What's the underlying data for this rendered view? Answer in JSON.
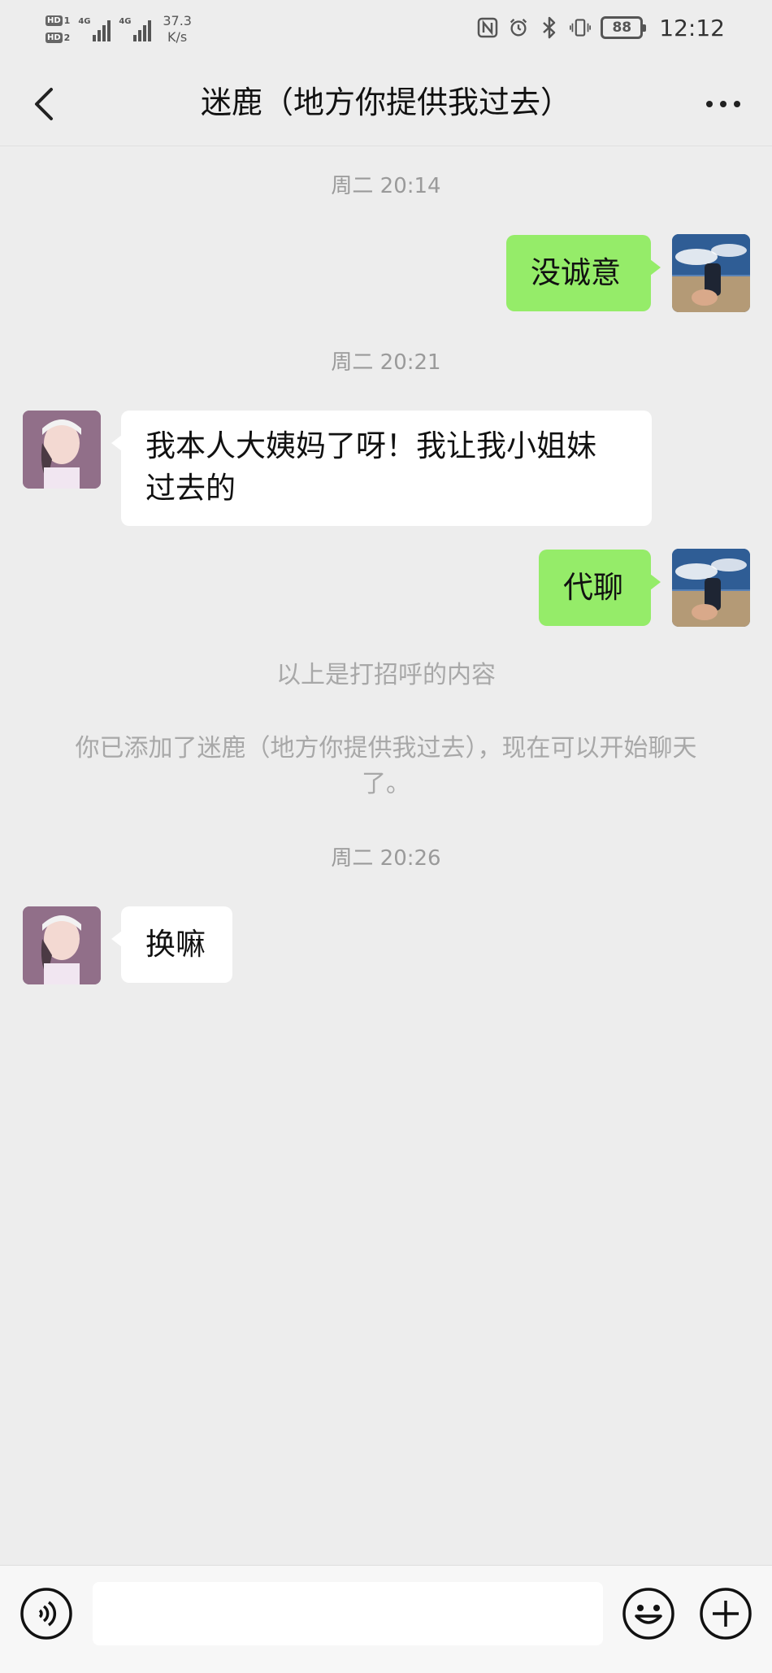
{
  "status_bar": {
    "hd1": "HD",
    "sim1": "1",
    "hd2": "HD",
    "sim2": "2",
    "signal1_tag": "4G",
    "signal2_tag": "4G",
    "net_speed_value": "37.3",
    "net_speed_unit": "K/s",
    "battery": "88",
    "time": "12:12"
  },
  "header": {
    "title": "迷鹿（地方你提供我过去）"
  },
  "messages": {
    "ts1": "周二 20:14",
    "m1": "没诚意",
    "ts2": "周二 20:21",
    "m2_line1": "我本人大姨妈了呀！我让我小姐妹",
    "m2_line2": "过去的",
    "m3": "代聊",
    "notice1": "以上是打招呼的内容",
    "notice2": "你已添加了迷鹿（地方你提供我过去），现在可以开始聊天了。",
    "ts3": "周二 20:26",
    "m4": "换嘛"
  },
  "input_bar": {
    "value": ""
  },
  "colors": {
    "background": "#ededed",
    "outgoing_bubble": "#95ec69",
    "incoming_bubble": "#ffffff"
  },
  "icons": {
    "back": "chevron-left-icon",
    "more": "more-dots-icon",
    "voice": "voice-icon",
    "emoji": "emoji-icon",
    "plus": "plus-icon"
  }
}
